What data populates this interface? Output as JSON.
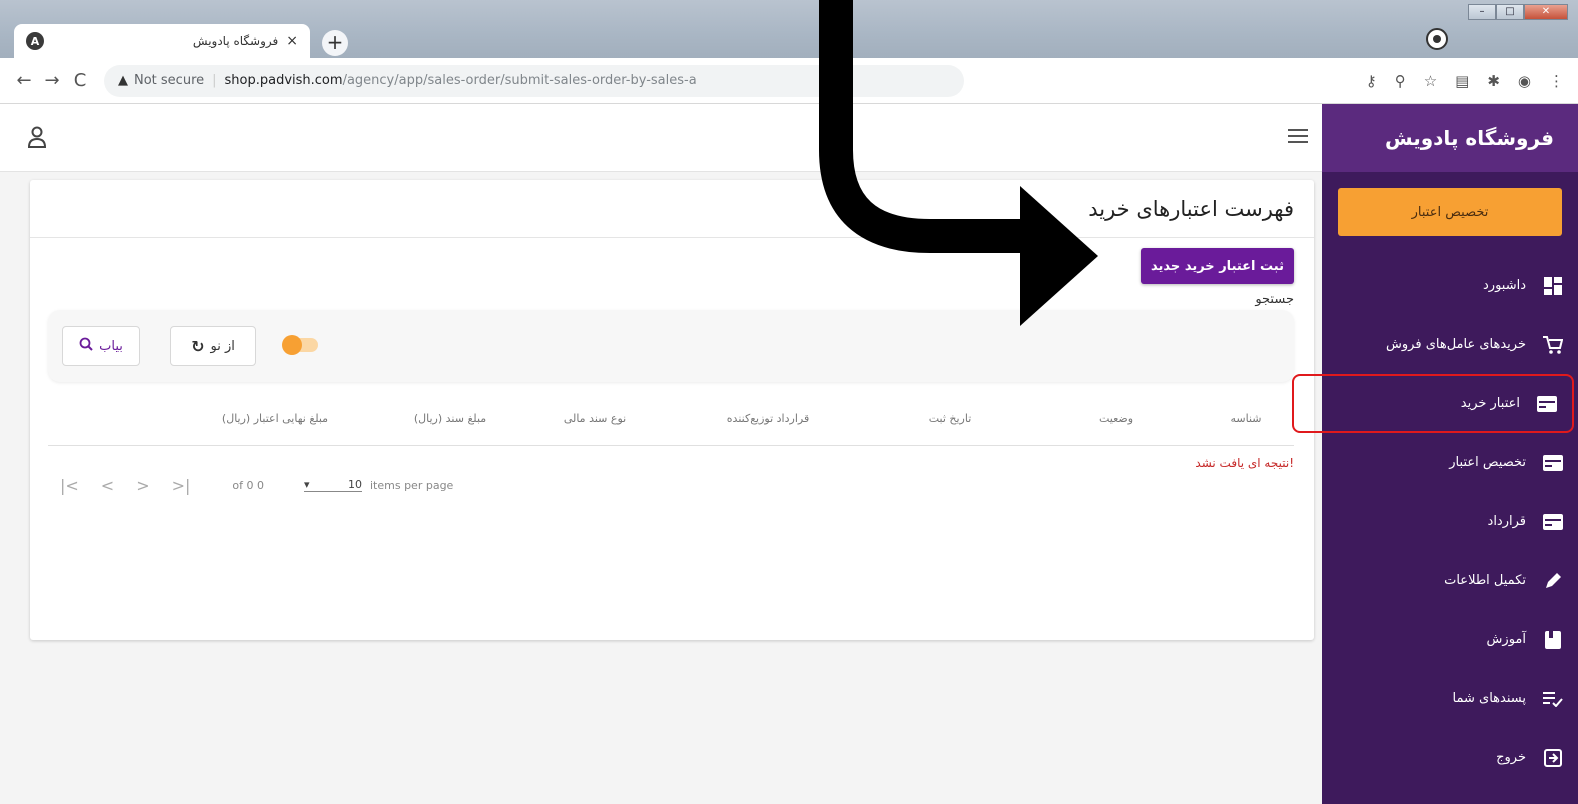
{
  "browser": {
    "tab_title": "فروشگاه پادویش",
    "tab_close": "×",
    "new_tab": "+",
    "security": "Not secure",
    "url_host": "shop.padvish.com",
    "url_path": "/agency/app/sales-order/submit-sales-order-by-sales-a"
  },
  "sidebar": {
    "brand": "فروشگاه پادویش",
    "allot_button": "تخصیص اعتبار",
    "items": [
      {
        "label": "داشبورد",
        "icon": "dashboard-icon"
      },
      {
        "label": "خریدهای عامل‌های فروش",
        "icon": "cart-icon"
      },
      {
        "label": "اعتبار خرید",
        "icon": "card-icon"
      },
      {
        "label": "تخصیص اعتبار",
        "icon": "card-icon"
      },
      {
        "label": "قرارداد",
        "icon": "card-icon"
      },
      {
        "label": "تکمیل اطلاعات",
        "icon": "pencil-icon"
      },
      {
        "label": "آموزش",
        "icon": "book-icon"
      },
      {
        "label": "پسندهای شما",
        "icon": "playlist-check-icon"
      },
      {
        "label": "خروج",
        "icon": "logout-icon"
      }
    ]
  },
  "main": {
    "title": "فهرست اعتبارهای خرید",
    "new_button": "ثبت اعتبار خرید جدید",
    "search_label": "جستجو",
    "find_button": "بیاب",
    "reset_button": "از نو",
    "columns": [
      "شناسه",
      "وضعیت",
      "تاریخ ثبت",
      "قرارداد توزیع‌کننده",
      "نوع سند مالی",
      "مبلغ سند (ریال)",
      "مبلغ نهایی اعتبار (ریال)"
    ],
    "no_result": "نتیجه ای یافت نشد!",
    "paginator": {
      "range": "of 0 0",
      "page_size": "10",
      "items_per_page": "items per page"
    }
  }
}
